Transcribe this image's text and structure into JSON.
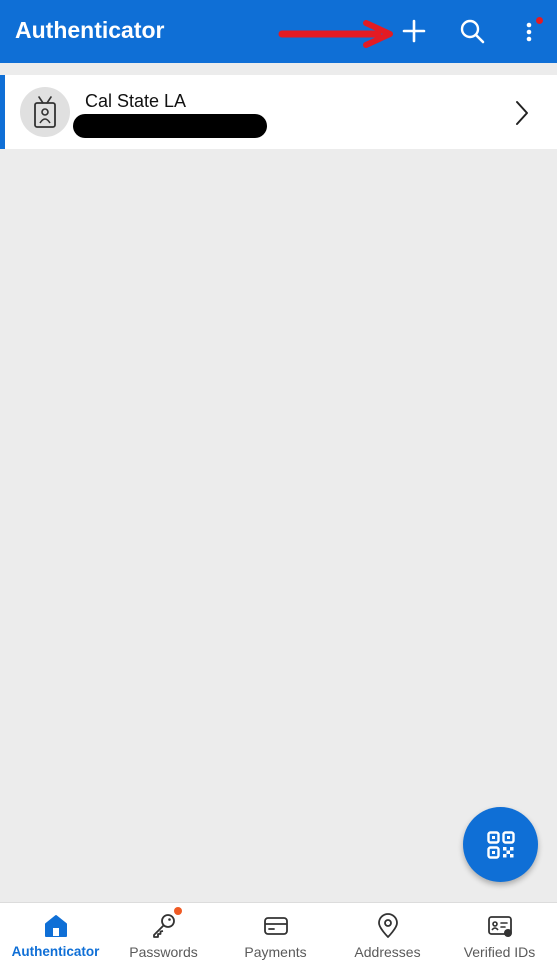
{
  "app": {
    "title": "Authenticator",
    "accent_color": "#0f6fd6",
    "background_color": "#ececec"
  },
  "toolbar": {
    "actions": [
      {
        "icon": "add-icon"
      },
      {
        "icon": "search-icon"
      },
      {
        "icon": "more-vertical-icon",
        "has_notification": true
      }
    ]
  },
  "annotation": {
    "icon": "red-arrow-icon",
    "color": "#e31b23"
  },
  "accounts": [
    {
      "name": "Cal State LA",
      "icon": "badge-id-icon",
      "username_redacted": true
    }
  ],
  "fab": {
    "icon": "qr-code-scan-icon"
  },
  "bottom_nav": {
    "items": [
      {
        "label": "Authenticator",
        "icon": "home-icon",
        "active": true
      },
      {
        "label": "Passwords",
        "icon": "key-icon",
        "badge": true
      },
      {
        "label": "Payments",
        "icon": "credit-card-icon"
      },
      {
        "label": "Addresses",
        "icon": "location-pin-icon"
      },
      {
        "label": "Verified IDs",
        "icon": "verified-id-icon"
      }
    ]
  }
}
